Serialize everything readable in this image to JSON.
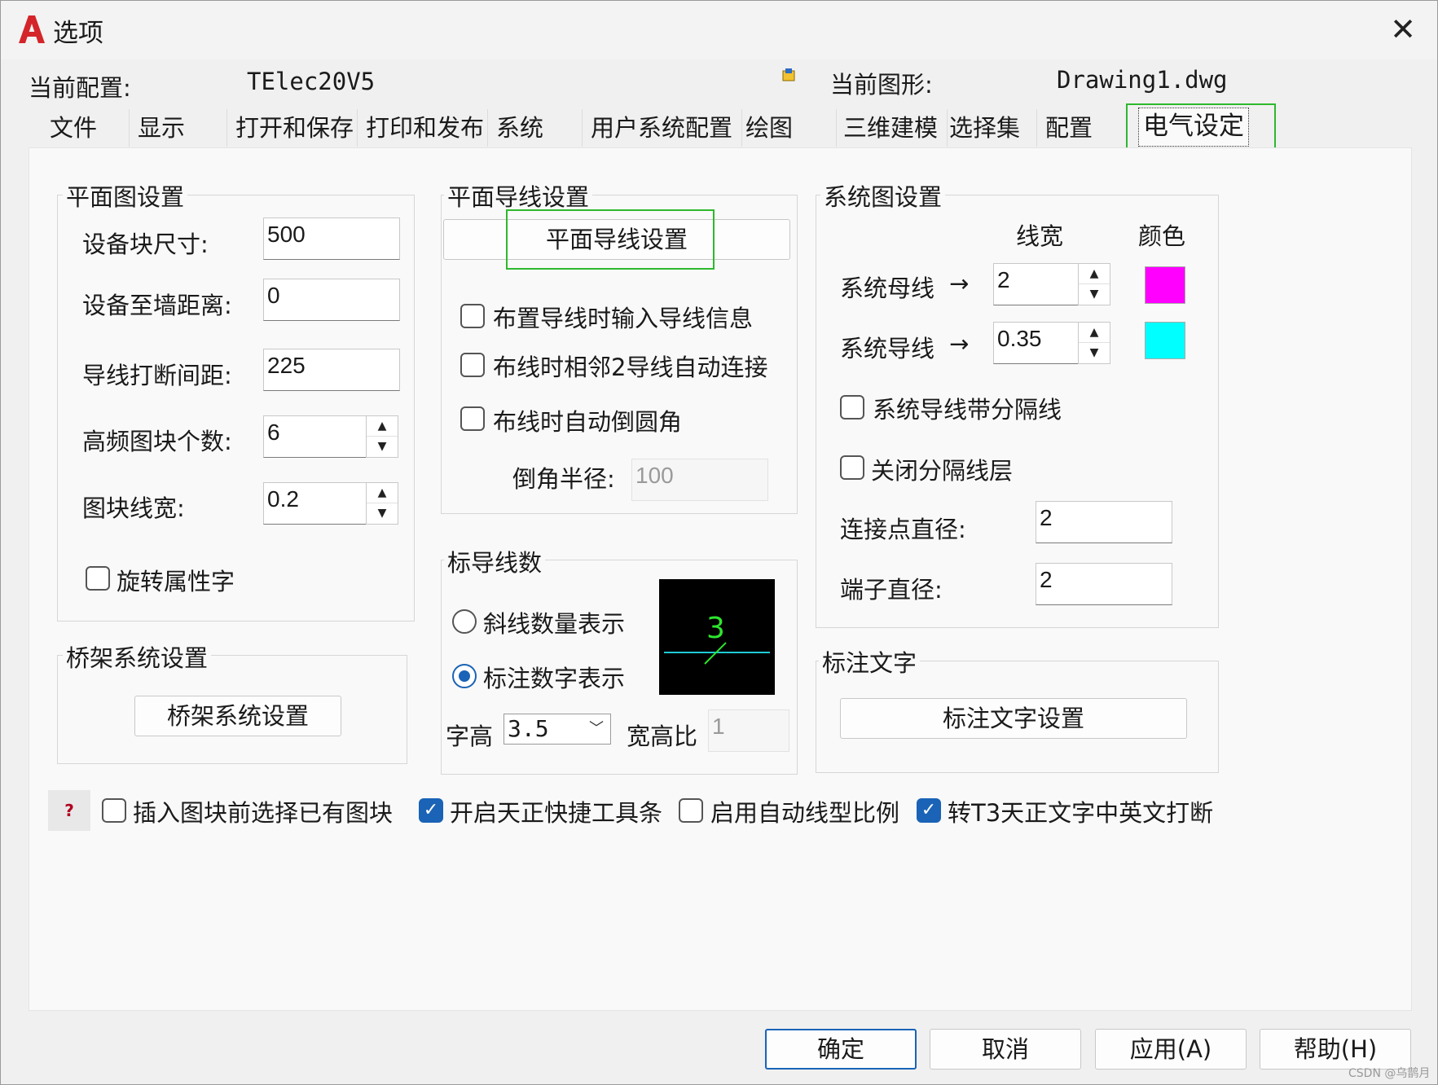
{
  "window": {
    "title": "选项"
  },
  "header": {
    "profile_label": "当前配置:",
    "profile_value": "TElec20V5",
    "drawing_label": "当前图形:",
    "drawing_value": "Drawing1.dwg"
  },
  "tabs": [
    "文件",
    "显示",
    "打开和保存",
    "打印和发布",
    "系统",
    "用户系统配置",
    "绘图",
    "三维建模",
    "选择集",
    "配置",
    "电气设定"
  ],
  "plan_settings": {
    "title": "平面图设置",
    "device_block_size_label": "设备块尺寸:",
    "device_block_size": "500",
    "device_wall_distance_label": "设备至墙距离:",
    "device_wall_distance": "0",
    "wire_break_gap_label": "导线打断间距:",
    "wire_break_gap": "225",
    "hf_block_count_label": "高频图块个数:",
    "hf_block_count": "6",
    "block_line_width_label": "图块线宽:",
    "block_line_width": "0.2",
    "rotate_attr_text_label": "旋转属性字"
  },
  "tray_settings": {
    "title": "桥架系统设置",
    "button": "桥架系统设置"
  },
  "plan_wire_settings": {
    "title": "平面导线设置",
    "button": "平面导线设置",
    "opt1": "布置导线时输入导线信息",
    "opt2": "布线时相邻2导线自动连接",
    "opt3": "布线时自动倒圆角",
    "fillet_radius_label": "倒角半径:",
    "fillet_radius": "100"
  },
  "wire_count_marking": {
    "title": "标导线数",
    "opt_slash": "斜线数量表示",
    "opt_number": "标注数字表示",
    "text_height_label": "字高",
    "text_height": "3.5",
    "aspect_ratio_label": "宽高比",
    "aspect_ratio": "1",
    "preview_number": "3"
  },
  "system_diagram": {
    "title": "系统图设置",
    "col_width": "线宽",
    "col_color": "颜色",
    "bus_label": "系统母线",
    "bus_width": "2",
    "bus_color": "#ff00ff",
    "wire_label": "系统导线",
    "wire_width": "0.35",
    "wire_color": "#00ffff",
    "arrow": "→",
    "separator_label": "系统导线带分隔线",
    "close_layer_label": "关闭分隔线层",
    "joint_diameter_label": "连接点直径:",
    "joint_diameter": "2",
    "terminal_diameter_label": "端子直径:",
    "terminal_diameter": "2"
  },
  "annotation_text": {
    "title": "标注文字",
    "button": "标注文字设置"
  },
  "bottom_options": {
    "help": "?",
    "opt1": "插入图块前选择已有图块",
    "opt1_checked": false,
    "opt2": "开启天正快捷工具条",
    "opt2_checked": true,
    "opt3": "启用自动线型比例",
    "opt3_checked": false,
    "opt4": "转T3天正文字中英文打断",
    "opt4_checked": true
  },
  "buttons": {
    "ok": "确定",
    "cancel": "取消",
    "apply": "应用(A)",
    "help": "帮助(H)"
  },
  "watermark": "CSDN @乌鹊月"
}
